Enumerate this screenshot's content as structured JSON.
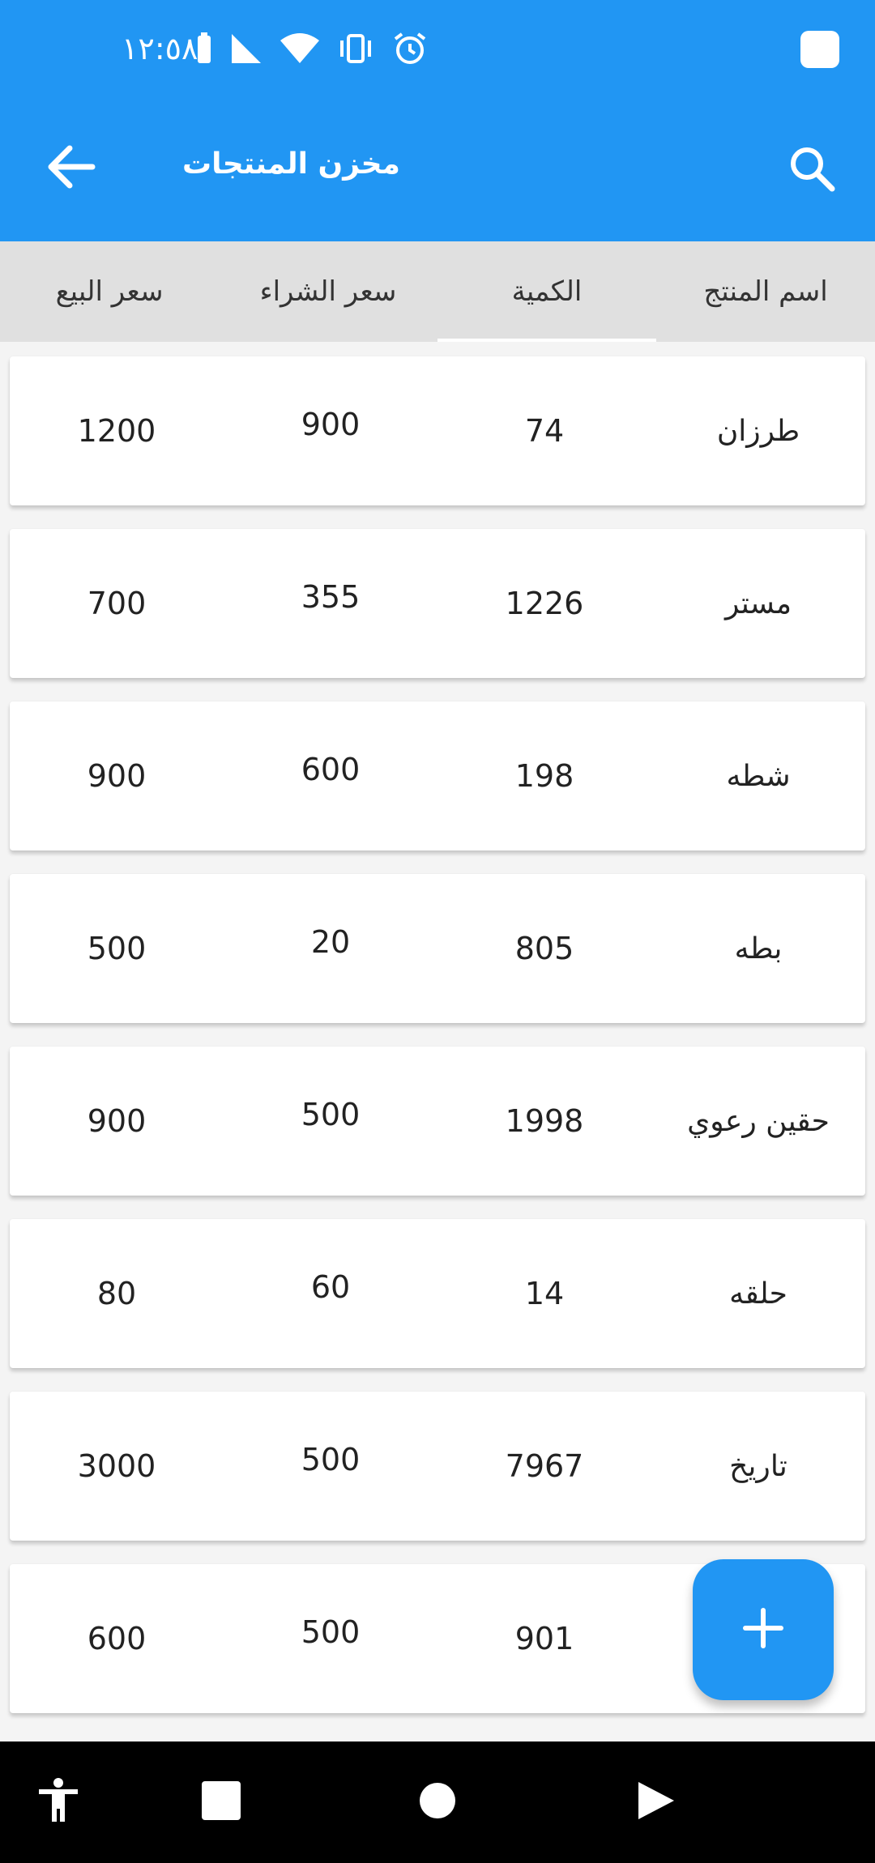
{
  "status_bar": {
    "time": "١٢:٥٨"
  },
  "app_bar": {
    "title": "مخزن المنتجات",
    "back_icon": "arrow-back-icon",
    "search_icon": "search-icon"
  },
  "columns": {
    "headers": [
      "اسم المنتج",
      "الكمية",
      "سعر الشراء",
      "سعر البيع"
    ],
    "active_index": 1
  },
  "products": [
    {
      "name": "طرزان",
      "quantity": "74",
      "buy_price": "900",
      "sell_price": "1200"
    },
    {
      "name": "مستر",
      "quantity": "1226",
      "buy_price": "355",
      "sell_price": "700"
    },
    {
      "name": "شطه",
      "quantity": "198",
      "buy_price": "600",
      "sell_price": "900"
    },
    {
      "name": "بطه",
      "quantity": "805",
      "buy_price": "20",
      "sell_price": "500"
    },
    {
      "name": "حقين رعوي",
      "quantity": "1998",
      "buy_price": "500",
      "sell_price": "900"
    },
    {
      "name": "حلقه",
      "quantity": "14",
      "buy_price": "60",
      "sell_price": "80"
    },
    {
      "name": "تاريخ",
      "quantity": "7967",
      "buy_price": "500",
      "sell_price": "3000"
    },
    {
      "name": "",
      "quantity": "901",
      "buy_price": "500",
      "sell_price": "600"
    }
  ],
  "fab": {
    "icon": "plus-icon"
  },
  "colors": {
    "primary": "#2196F3",
    "header_bg": "#e0e0e0",
    "nav_bg": "#000000"
  }
}
